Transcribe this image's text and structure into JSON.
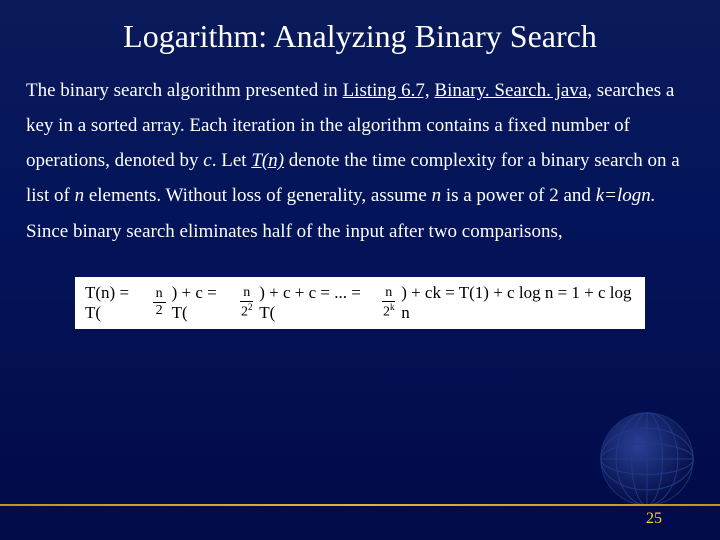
{
  "title": "Logarithm: Analyzing Binary Search",
  "body": {
    "t1": "The binary search algorithm presented in ",
    "link1": "Listing 6.7,",
    "t2": " ",
    "link2": "Binary. Search. java",
    "t3": ", searches a key in a sorted array. Each iteration in the algorithm contains a fixed number of operations, denoted by ",
    "c": "c",
    "t4": ". Let ",
    "tn": "T(n)",
    "t5": " denote the time complexity for a binary search on a list of  ",
    "n1": "n",
    "t6": " elements. Without loss of generality, assume ",
    "n2": "n",
    "t7": " is a power of 2 and ",
    "klogn": "k=logn.",
    "t8": " Since binary search eliminates half of the input after two comparisons,"
  },
  "equation": {
    "p1": "T(n) = T(",
    "f1n": "n",
    "f1d": "2",
    "p2": ") + c = T(",
    "f2n": "n",
    "f2d": "2",
    "f2e": "2",
    "p3": ") + c + c = ... = T(",
    "f3n": "n",
    "f3d": "2",
    "f3e": "k",
    "p4": ") + ck = T(1) + c log n = 1 + c log n"
  },
  "page": "25"
}
